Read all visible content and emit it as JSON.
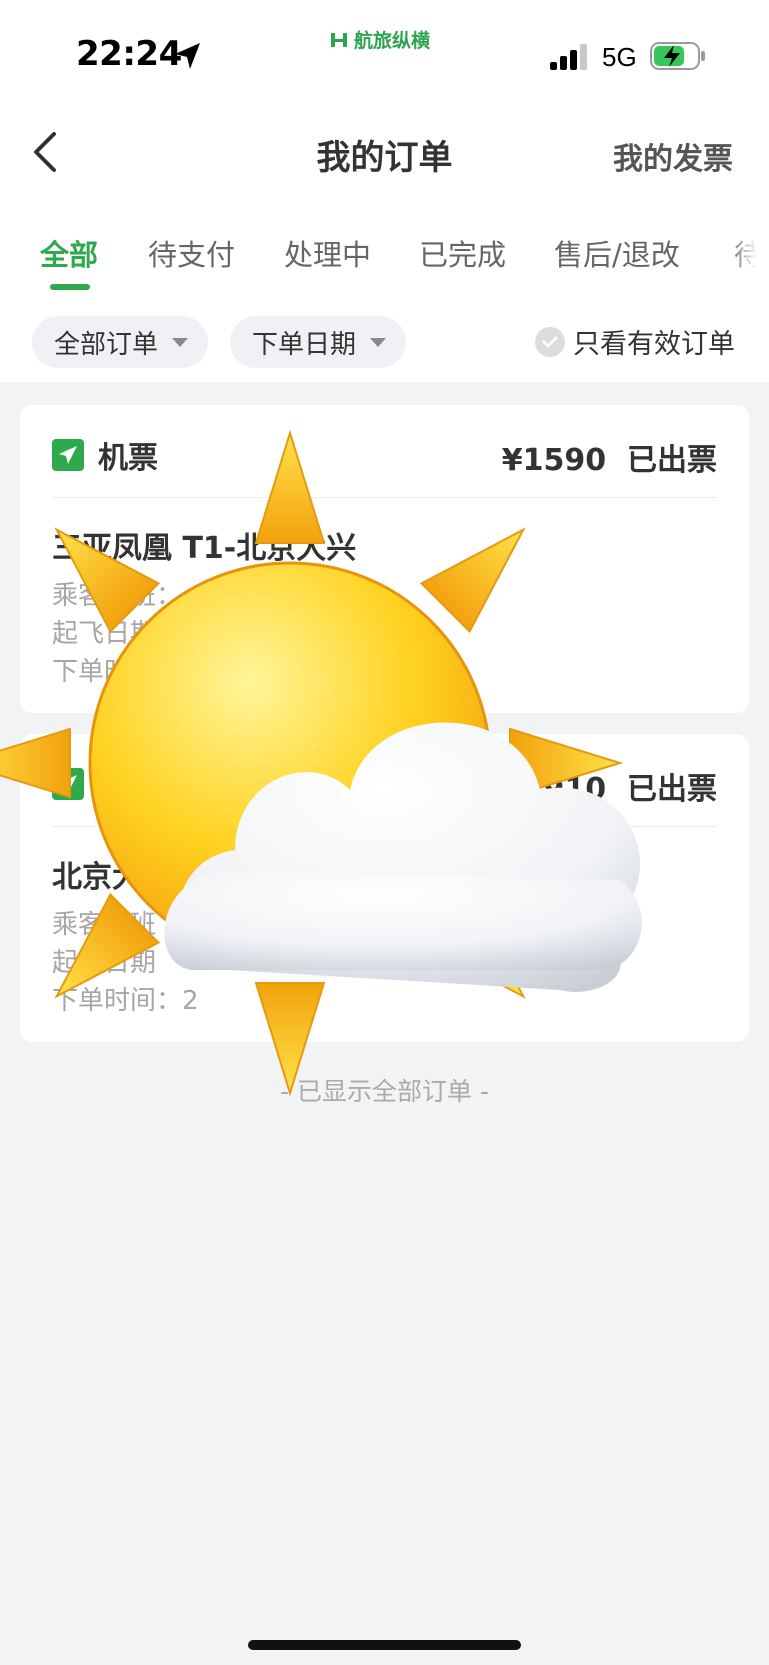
{
  "status_bar": {
    "time": "22:24",
    "brand": "航旅纵横",
    "network": "5G",
    "icons": [
      "location-arrow-icon",
      "signal-icon",
      "battery-charging-icon"
    ]
  },
  "header": {
    "title": "我的订单",
    "invoice_link": "我的发票",
    "back_icon": "chevron-left-icon"
  },
  "tabs": [
    {
      "label": "全部",
      "active": true
    },
    {
      "label": "待支付",
      "active": false
    },
    {
      "label": "处理中",
      "active": false
    },
    {
      "label": "已完成",
      "active": false
    },
    {
      "label": "售后/退改",
      "active": false
    },
    {
      "label": "待",
      "active": false
    }
  ],
  "filters": {
    "order_type": "全部订单",
    "order_date": "下单日期",
    "valid_only": "只看有效订单"
  },
  "orders": [
    {
      "type": "机票",
      "price": "¥1590",
      "status": "已出票",
      "route": "三亚凤凰 T1-北京大兴",
      "passenger_flight": "乘客航班：",
      "departure": "起飞日期",
      "ordered": "下单时间"
    },
    {
      "type": "机票",
      "price": "¥1910",
      "status": "已出票",
      "route": "北京大兴",
      "passenger_flight": "乘客航班",
      "departure": "起飞日期",
      "ordered": "下单时间：2"
    }
  ],
  "footer_note": "- 已显示全部订单 -",
  "overlay": {
    "icon": "sun-behind-cloud-icon"
  },
  "colors": {
    "accent": "#2eaa4c",
    "page_bg": "#f2f3f5",
    "card_bg": "#ffffff"
  }
}
